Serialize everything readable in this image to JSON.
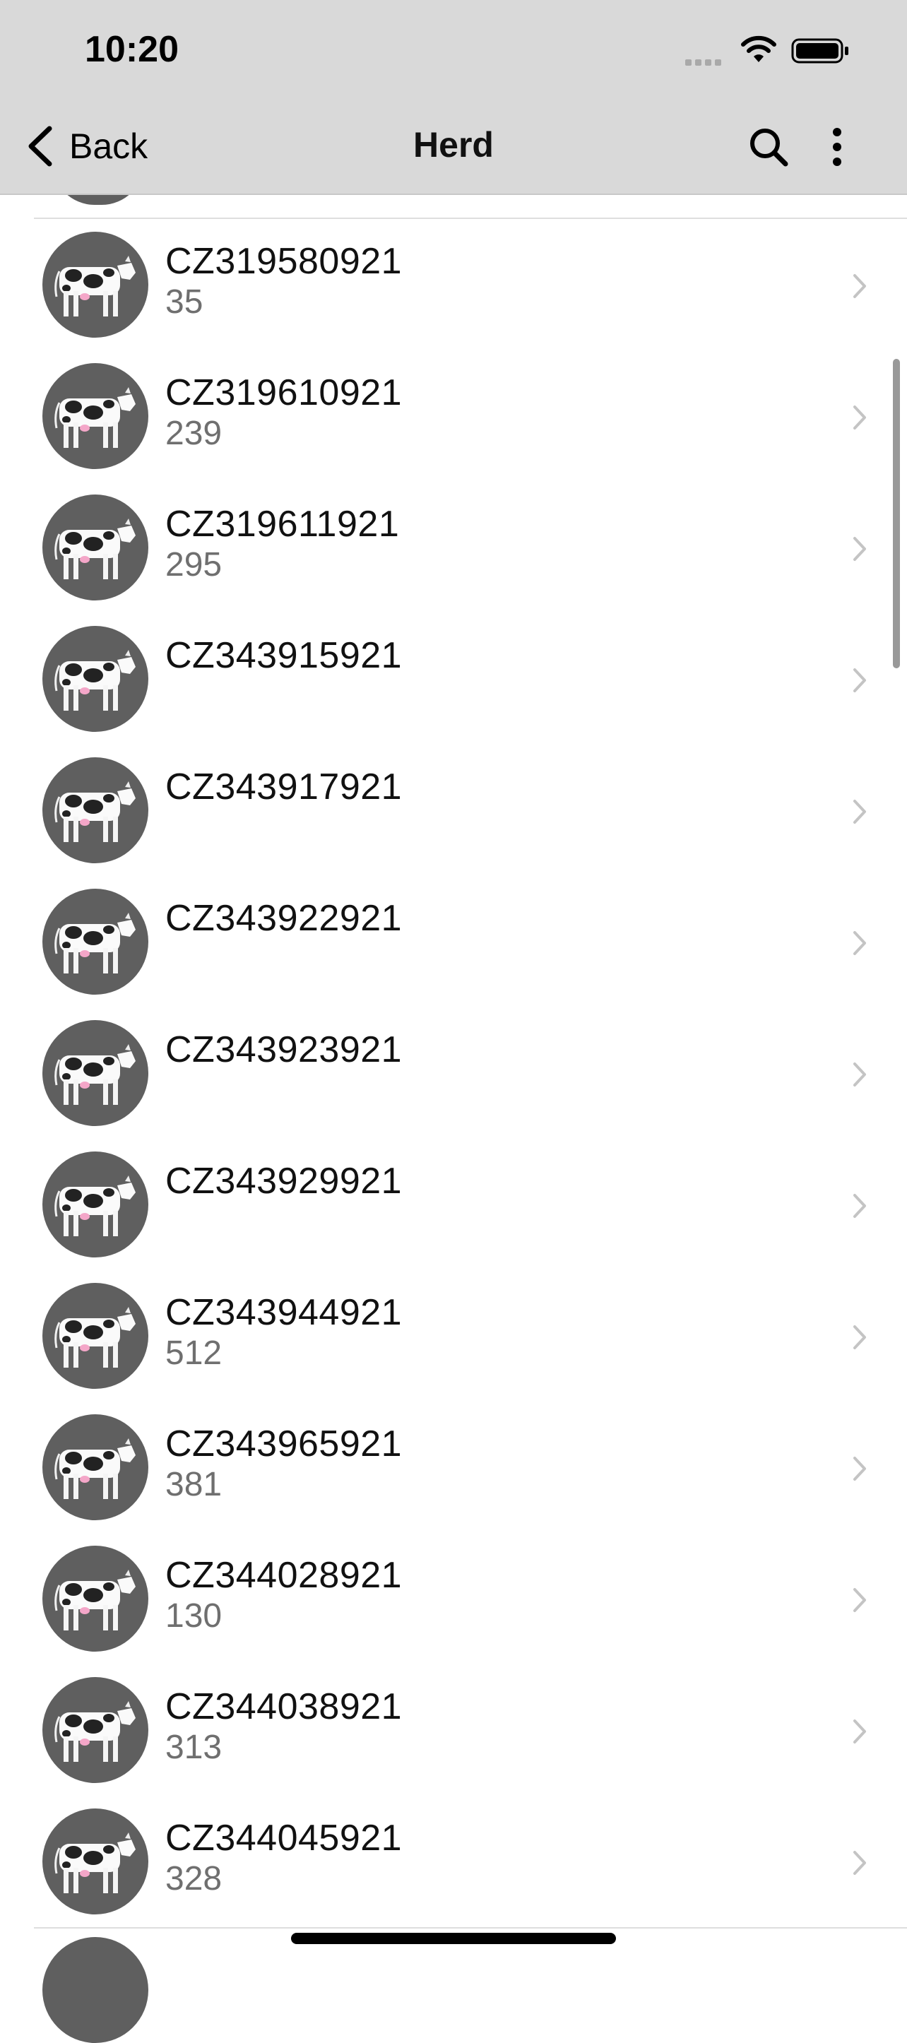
{
  "status_bar": {
    "time": "10:20"
  },
  "nav": {
    "back_label": "Back",
    "title": "Herd"
  },
  "animals": [
    {
      "id": "CZ319580921",
      "number": "35"
    },
    {
      "id": "CZ319610921",
      "number": "239"
    },
    {
      "id": "CZ319611921",
      "number": "295"
    },
    {
      "id": "CZ343915921",
      "number": ""
    },
    {
      "id": "CZ343917921",
      "number": ""
    },
    {
      "id": "CZ343922921",
      "number": ""
    },
    {
      "id": "CZ343923921",
      "number": ""
    },
    {
      "id": "CZ343929921",
      "number": ""
    },
    {
      "id": "CZ343944921",
      "number": "512"
    },
    {
      "id": "CZ343965921",
      "number": "381"
    },
    {
      "id": "CZ344028921",
      "number": "130"
    },
    {
      "id": "CZ344038921",
      "number": "313"
    },
    {
      "id": "CZ344045921",
      "number": "328"
    }
  ],
  "colors": {
    "header_bg": "#d9d9d9",
    "avatar_bg": "#5f5f5f",
    "secondary_text": "#6f6f6f",
    "chevron": "#c4c4c4"
  },
  "icons": [
    "chevron-left-icon",
    "search-icon",
    "more-vertical-icon",
    "cow-icon",
    "chevron-right-icon",
    "wifi-icon",
    "battery-icon",
    "signal-icon"
  ]
}
